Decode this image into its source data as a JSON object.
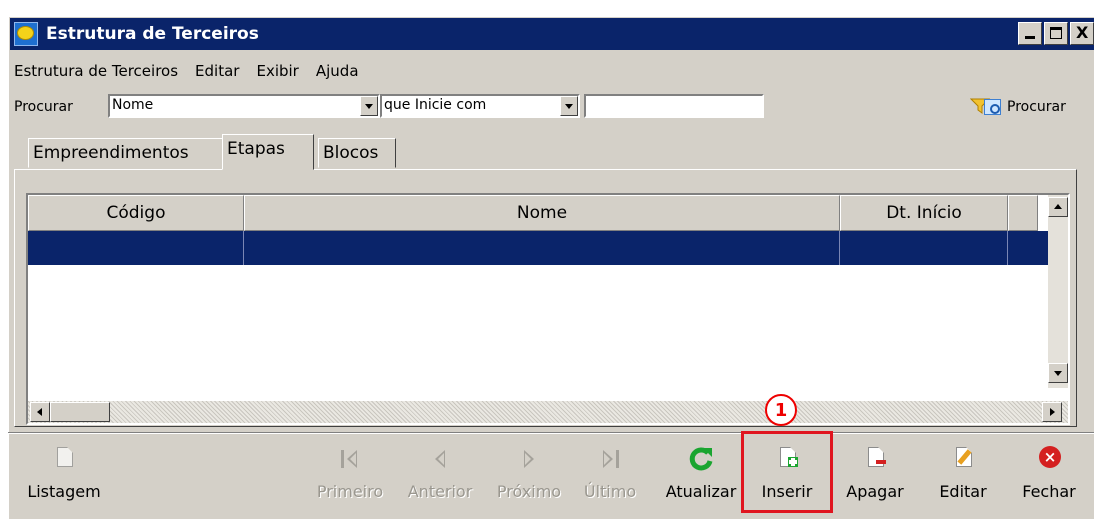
{
  "window": {
    "title": "Estrutura de Terceiros",
    "controls": {
      "minimize": "_",
      "maximize": "□",
      "close": "X"
    }
  },
  "menu": [
    "Estrutura de Terceiros",
    "Editar",
    "Exibir",
    "Ajuda"
  ],
  "search": {
    "label": "Procurar",
    "field_value": "Nome",
    "condition_value": "que Inicie com",
    "text_value": "",
    "button_label": "Procurar",
    "filter_icon": "funnel-icon",
    "search_icon": "search-window-icon"
  },
  "tabs": [
    {
      "label": "Empreendimentos",
      "active": false
    },
    {
      "label": "Etapas",
      "active": true
    },
    {
      "label": "Blocos",
      "active": false
    }
  ],
  "grid": {
    "columns": [
      "Código",
      "Nome",
      "Dt. Início"
    ],
    "rows": [
      {
        "selected": true,
        "cells": [
          "",
          "",
          "",
          ""
        ]
      }
    ]
  },
  "annotation": {
    "number": "1",
    "color": "#e0151f"
  },
  "toolbar": {
    "listagem": "Listagem",
    "primeiro": "Primeiro",
    "anterior": "Anterior",
    "proximo": "Próximo",
    "ultimo": "Último",
    "atualizar": "Atualizar",
    "inserir": "Inserir",
    "apagar": "Apagar",
    "editar": "Editar",
    "fechar": "Fechar"
  },
  "colors": {
    "titlebar": "#0a246a",
    "face": "#d4d0c8",
    "selection": "#0a246a",
    "refresh_green": "#1aa530",
    "close_red": "#d42020"
  }
}
